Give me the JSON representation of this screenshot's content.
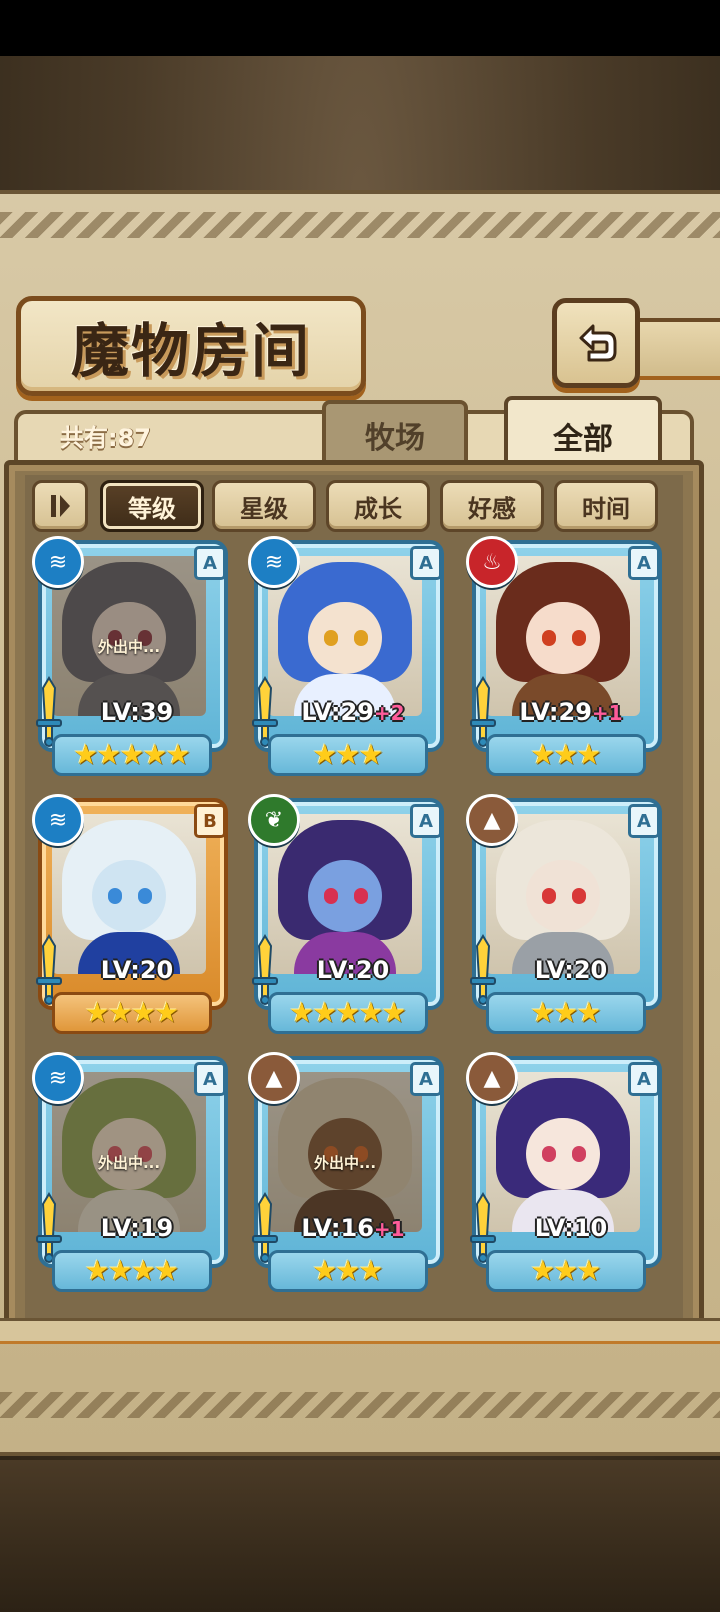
{
  "title": "魔物房间",
  "header": {
    "count_label": "共有:87"
  },
  "tabs": [
    {
      "label": "牧场",
      "active": false
    },
    {
      "label": "全部",
      "active": true
    }
  ],
  "sort": {
    "toggle_icon": "sort-order-icon",
    "buttons": [
      {
        "label": "等级",
        "active": true
      },
      {
        "label": "星级",
        "active": false
      },
      {
        "label": "成长",
        "active": false
      },
      {
        "label": "好感",
        "active": false
      },
      {
        "label": "时间",
        "active": false
      }
    ]
  },
  "element_colors": {
    "water": "#1d7fc4",
    "fire": "#c8252a",
    "wood": "#2f7a2c",
    "earth": "#8a5a3a"
  },
  "monsters": [
    {
      "element": "water",
      "rank": "A",
      "level": "LV:39",
      "bonus": "",
      "stars": 5,
      "away": true,
      "away_label": "外出中...",
      "palette": [
        "#5b5b66",
        "#e8d8cc",
        "#8a3040",
        "#6a6a72"
      ]
    },
    {
      "element": "water",
      "rank": "A",
      "level": "LV:29",
      "bonus": "+2",
      "stars": 3,
      "away": false,
      "away_label": "",
      "palette": [
        "#3a6ad0",
        "#f4e2cf",
        "#e0a020",
        "#e8f0ff"
      ]
    },
    {
      "element": "fire",
      "rank": "A",
      "level": "LV:29",
      "bonus": "+1",
      "stars": 3,
      "away": false,
      "away_label": "",
      "palette": [
        "#6a2c1c",
        "#f6dccb",
        "#d04020",
        "#7a4a2a"
      ]
    },
    {
      "element": "water",
      "rank": "B",
      "level": "LV:20",
      "bonus": "",
      "stars": 4,
      "away": false,
      "away_label": "",
      "palette": [
        "#e6f0f6",
        "#cfe4f2",
        "#3a8ad8",
        "#2040a0"
      ]
    },
    {
      "element": "wood",
      "rank": "A",
      "level": "LV:20",
      "bonus": "",
      "stars": 5,
      "away": false,
      "away_label": "",
      "palette": [
        "#3a2a70",
        "#7aa0e0",
        "#d83050",
        "#8a3aa0"
      ]
    },
    {
      "element": "earth",
      "rank": "A",
      "level": "LV:20",
      "bonus": "",
      "stars": 3,
      "away": false,
      "away_label": "",
      "palette": [
        "#ece6da",
        "#f0e2d6",
        "#d83838",
        "#9aa0a6"
      ]
    },
    {
      "element": "water",
      "rank": "A",
      "level": "LV:19",
      "bonus": "",
      "stars": 4,
      "away": true,
      "away_label": "外出中...",
      "palette": [
        "#8aa050",
        "#f2e2cc",
        "#d85060",
        "#e6e0d0"
      ]
    },
    {
      "element": "earth",
      "rank": "A",
      "level": "LV:16",
      "bonus": "+1",
      "stars": 3,
      "away": true,
      "away_label": "外出中...",
      "palette": [
        "#d6c6aa",
        "#7a5030",
        "#d06020",
        "#5a3a24"
      ]
    },
    {
      "element": "earth",
      "rank": "A",
      "level": "LV:10",
      "bonus": "",
      "stars": 3,
      "away": false,
      "away_label": "",
      "palette": [
        "#3a2a7a",
        "#f6e6dc",
        "#d04060",
        "#eae6f0"
      ]
    }
  ]
}
